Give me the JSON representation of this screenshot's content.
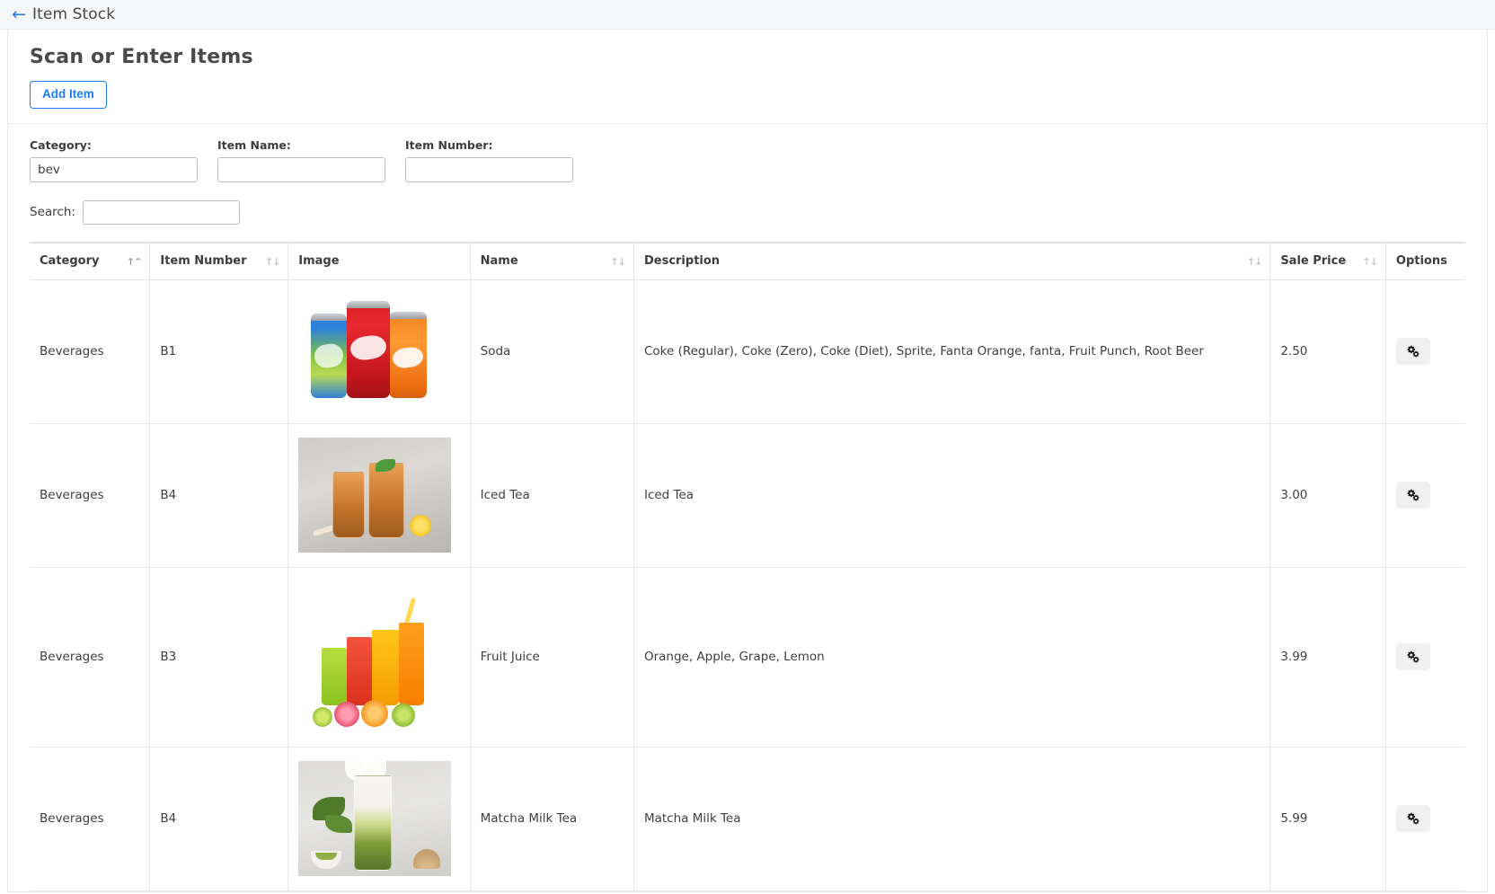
{
  "topbar": {
    "back_icon": "arrow-left-icon",
    "title": "Item Stock"
  },
  "panel": {
    "title": "Scan or Enter Items",
    "add_item_label": "Add Item"
  },
  "filters": [
    {
      "label": "Category:",
      "value": "bev",
      "placeholder": ""
    },
    {
      "label": "Item Name:",
      "value": "",
      "placeholder": ""
    },
    {
      "label": "Item Number:",
      "value": "",
      "placeholder": ""
    }
  ],
  "search": {
    "label": "Search:",
    "value": "",
    "placeholder": ""
  },
  "table": {
    "columns": [
      {
        "label": "Category",
        "sortable": true,
        "sort_state": "asc"
      },
      {
        "label": "Item Number",
        "sortable": true,
        "sort_state": "none"
      },
      {
        "label": "Image",
        "sortable": false,
        "sort_state": "none"
      },
      {
        "label": "Name",
        "sortable": true,
        "sort_state": "none"
      },
      {
        "label": "Description",
        "sortable": true,
        "sort_state": "none"
      },
      {
        "label": "Sale Price",
        "sortable": true,
        "sort_state": "none"
      },
      {
        "label": "Options",
        "sortable": false,
        "sort_state": "none"
      }
    ],
    "rows": [
      {
        "category": "Beverages",
        "item_number": "B1",
        "image_alt": "soda-cans-image",
        "name": "Soda",
        "description": "Coke (Regular), Coke (Zero), Coke (Diet), Sprite, Fanta Orange, fanta, Fruit Punch, Root Beer",
        "sale_price": "2.50",
        "options_icon": "gears-icon"
      },
      {
        "category": "Beverages",
        "item_number": "B4",
        "image_alt": "iced-tea-image",
        "name": "Iced Tea",
        "description": "Iced Tea",
        "sale_price": "3.00",
        "options_icon": "gears-icon"
      },
      {
        "category": "Beverages",
        "item_number": "B3",
        "image_alt": "fruit-juice-image",
        "name": "Fruit Juice",
        "description": "Orange, Apple, Grape, Lemon",
        "sale_price": "3.99",
        "options_icon": "gears-icon"
      },
      {
        "category": "Beverages",
        "item_number": "B4",
        "image_alt": "matcha-milk-tea-image",
        "name": "Matcha Milk Tea",
        "description": "Matcha Milk Tea",
        "sale_price": "5.99",
        "options_icon": "gears-icon"
      }
    ]
  },
  "colors": {
    "accent": "#1c7ef3",
    "topbar_bg": "#f5f6f7",
    "text": "#3f3f3f",
    "border": "#e8eaec"
  }
}
